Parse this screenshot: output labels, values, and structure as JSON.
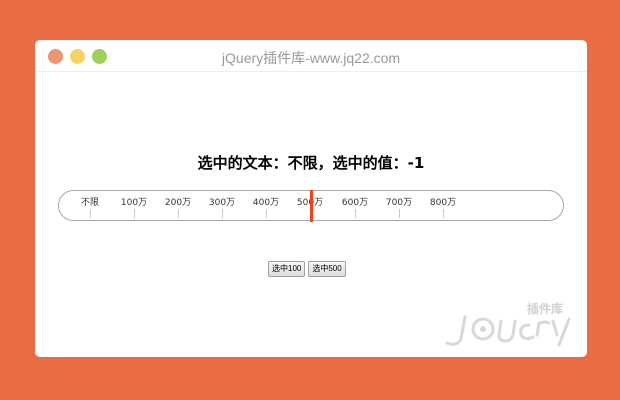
{
  "window": {
    "title": "jQuery插件库-www.jq22.com"
  },
  "heading": "选中的文本：不限，选中的值：-1",
  "range": {
    "ticks": [
      "不限",
      "100万",
      "200万",
      "300万",
      "400万",
      "500万",
      "600万",
      "700万",
      "800万"
    ],
    "selected_value": -1,
    "selected_text": "不限",
    "accent_color": "#e8461c"
  },
  "buttons": {
    "select100": "选中100",
    "select500": "选中500"
  },
  "watermark": {
    "brand": "jQuery",
    "sub": "插件库"
  },
  "colors": {
    "background": "#e96c45",
    "window": "#ffffff"
  }
}
